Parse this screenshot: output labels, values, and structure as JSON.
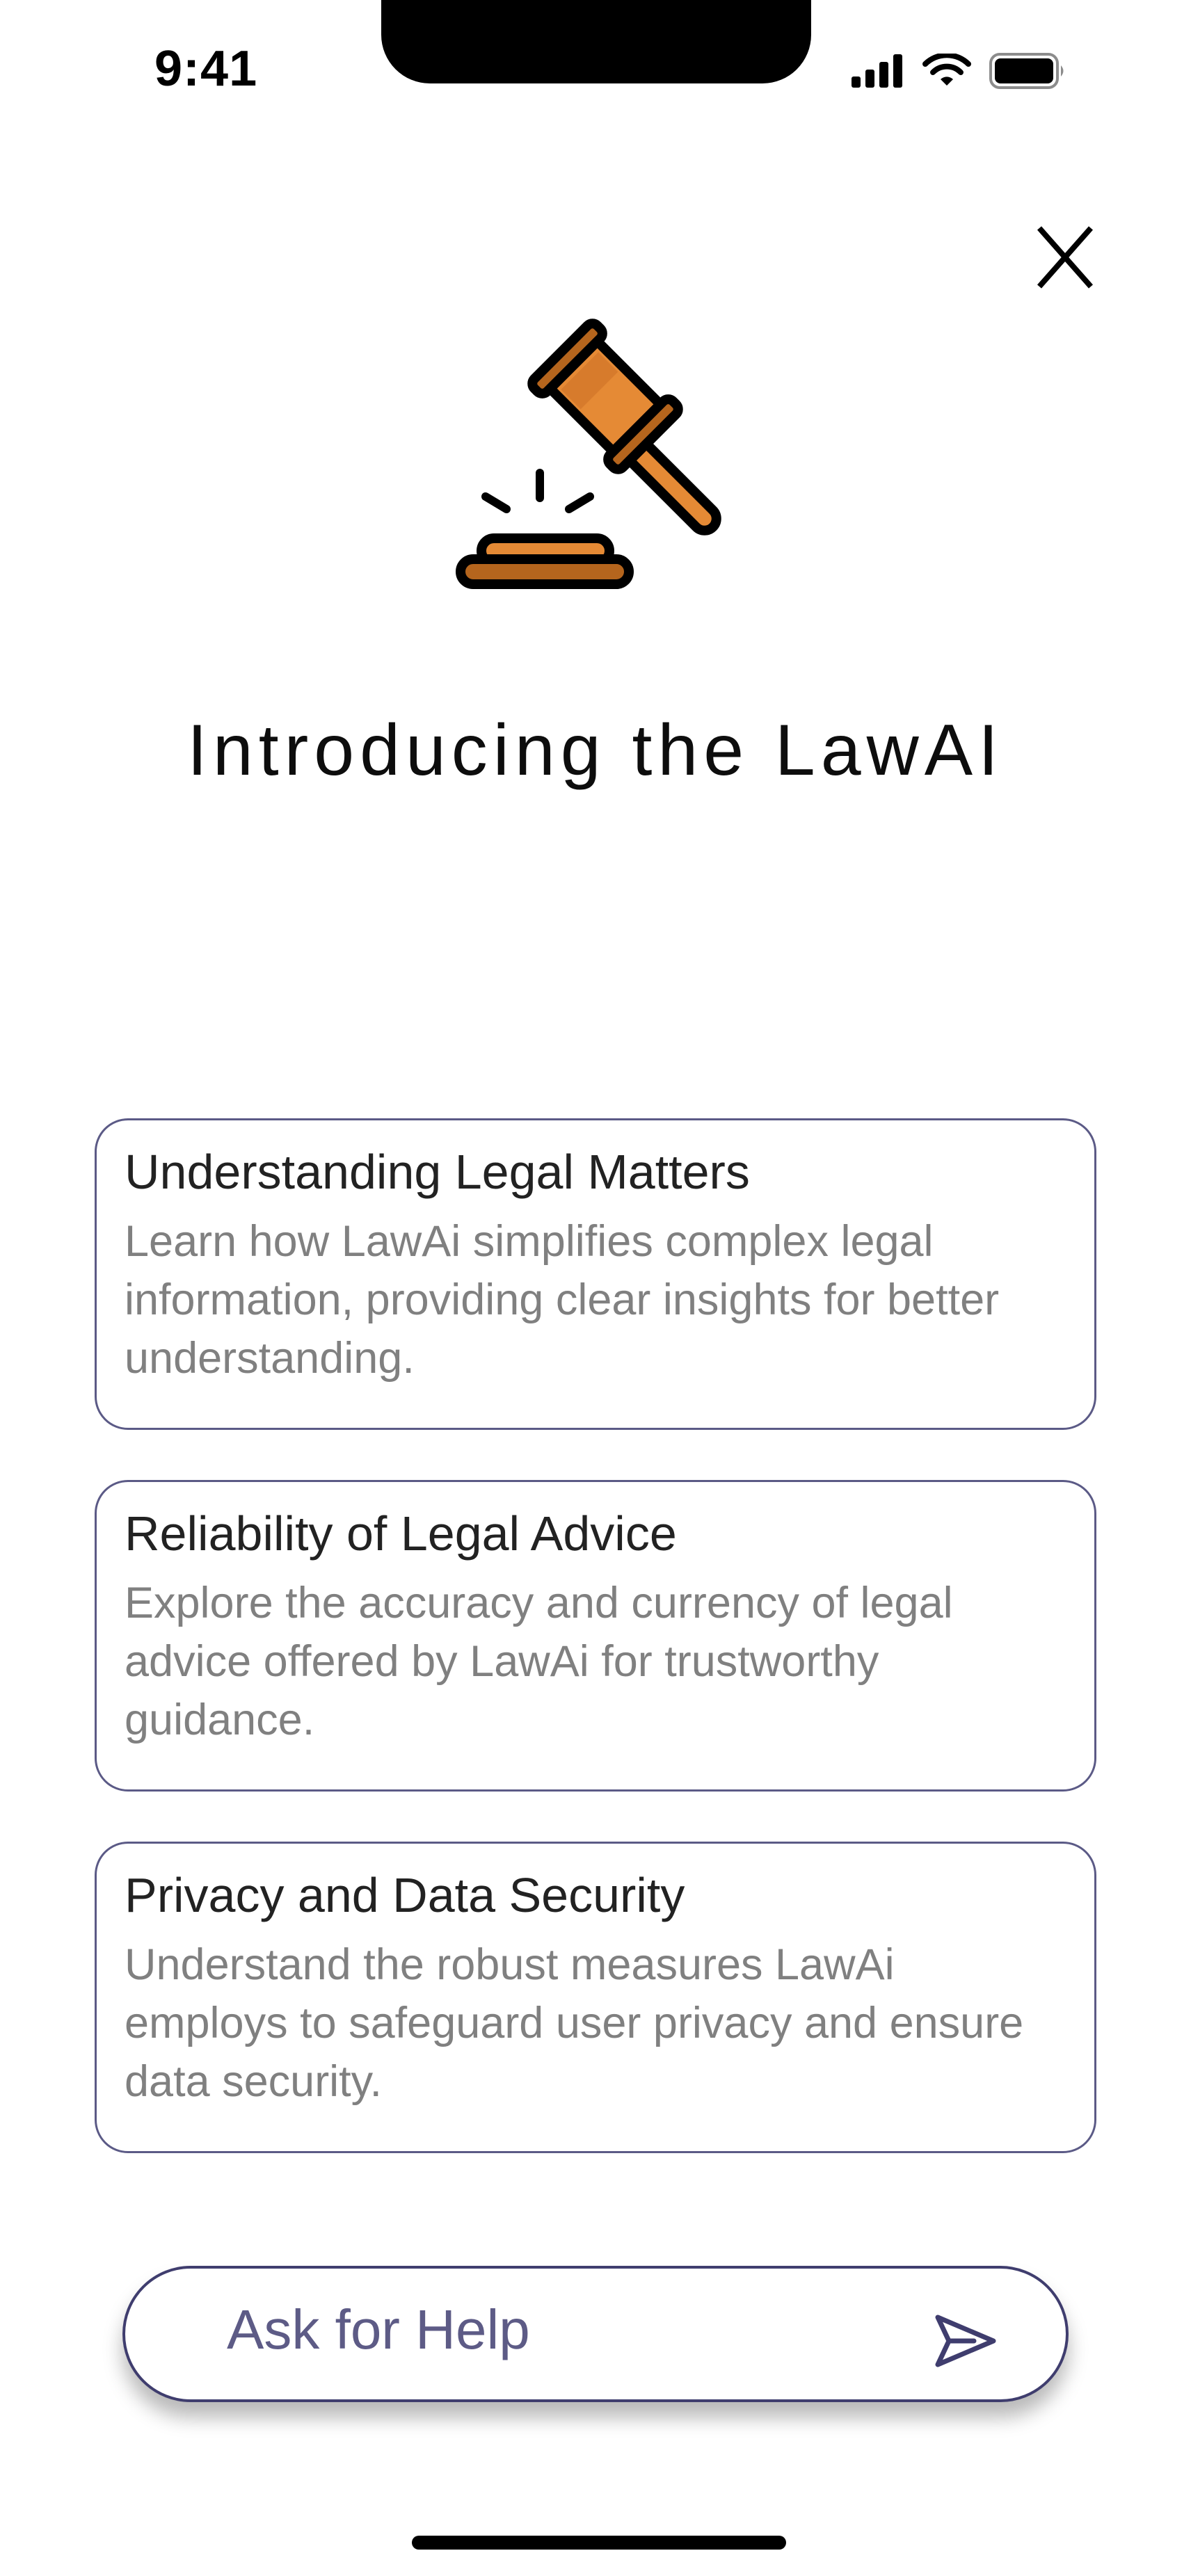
{
  "status_bar": {
    "time": "9:41",
    "icons": [
      "signal-icon",
      "wifi-icon",
      "battery-icon"
    ]
  },
  "header": {
    "close_label": "X",
    "hero_icon": "gavel-icon",
    "title": "Introducing the LawAI"
  },
  "cards": [
    {
      "title": "Understanding Legal Matters",
      "description": "Learn how LawAi simplifies complex legal information, providing clear insights for better understanding."
    },
    {
      "title": "Reliability of Legal Advice",
      "description": "Explore the accuracy and currency of legal advice offered by LawAi for trustworthy guidance."
    },
    {
      "title": "Privacy and Data Security",
      "description": "Understand the robust measures LawAi employs to safeguard user privacy and ensure data security."
    }
  ],
  "ask_bar": {
    "label": "Ask for Help",
    "icon": "send-icon"
  },
  "colors": {
    "card_border": "#5b5a86",
    "ask_text": "#5d5b86",
    "gavel_orange": "#e58a35",
    "gavel_dark": "#b5651d"
  }
}
